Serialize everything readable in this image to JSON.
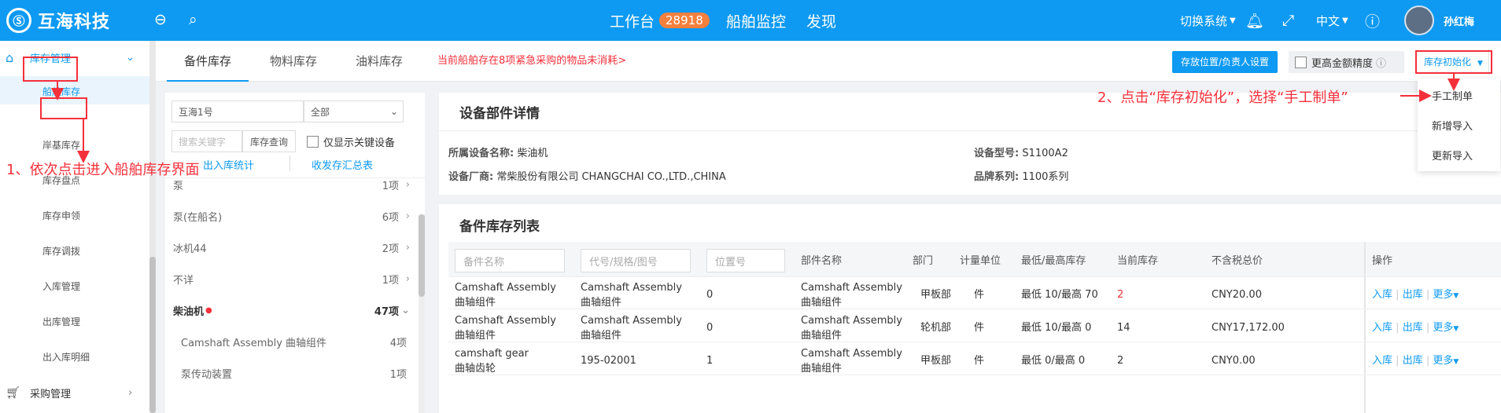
{
  "header": {
    "logo_mark": "Ⓢ",
    "app_name": "互海科技",
    "nav_workbench": "工作台",
    "workbench_badge": "28918",
    "nav_ship_monitor": "船舶监控",
    "nav_discover": "发现",
    "switch_system": "切换系统",
    "language": "中文",
    "user_name": "孙红梅"
  },
  "sidebar": {
    "group_inventory": "库存管理",
    "items": [
      "船舶库存",
      "岸基库存",
      "库存盘点",
      "库存申领",
      "库存调拨",
      "入库管理",
      "出库管理",
      "出入库明细"
    ],
    "group_purchase": "采购管理"
  },
  "tabs": [
    "备件库存",
    "物料库存",
    "油料库存"
  ],
  "warning": "当前船舶存在8项紧急采购的物品未消耗>",
  "toolbar": {
    "storage_setting": "存放位置/负责人设置",
    "high_precision": "更高金额精度",
    "init_button": "库存初始化"
  },
  "dropdown": [
    "手工制单",
    "新增导入",
    "更新导入"
  ],
  "left": {
    "ship": "互海1号",
    "filter": "全部",
    "search_placeholder": "搜索关键字",
    "search_btn": "库存查询",
    "key_only": "仅显示关键设备",
    "link_stats": "出入库统计",
    "link_summary": "收发存汇总表",
    "rows": [
      {
        "name": "泵",
        "count": "1项"
      },
      {
        "name": "泵(在船名)",
        "count": "6项"
      },
      {
        "name": "冰机44",
        "count": "2项"
      },
      {
        "name": "不详",
        "count": "1项"
      },
      {
        "name": "柴油机",
        "count": "47项"
      },
      {
        "name": "Camshaft Assembly 曲轴组件",
        "count": "4项"
      },
      {
        "name": "泵传动装置",
        "count": "1项"
      }
    ]
  },
  "detail": {
    "title": "设备部件详情",
    "label_device": "所属设备名称:",
    "device": "柴油机",
    "label_model": "设备型号:",
    "model": "S1100A2",
    "label_maker": "设备厂商:",
    "maker": "常柴股份有限公司 CHANGCHAI CO.,LTD.,CHINA",
    "label_brand": "品牌系列:",
    "brand": "1100系列"
  },
  "table": {
    "title": "备件库存列表",
    "filters": [
      "备件名称",
      "代号/规格/图号",
      "位置号"
    ],
    "headers": [
      "部件名称",
      "部门",
      "计量单位",
      "最低/最高库存",
      "当前库存",
      "不含税总价",
      "操作"
    ],
    "rows": [
      {
        "name": "Camshaft Assembly 曲轴组件",
        "code": "Camshaft Assembly 曲轴组件",
        "loc": "0",
        "part": "Camshaft Assembly 曲轴组件",
        "dept": "甲板部",
        "unit": "件",
        "minmax": "最低 10/最高 70",
        "stock": "2",
        "price": "CNY20.00"
      },
      {
        "name": "Camshaft Assembly 曲轴组件",
        "code": "Camshaft Assembly 曲轴组件",
        "loc": "0",
        "part": "Camshaft Assembly 曲轴组件",
        "dept": "轮机部",
        "unit": "件",
        "minmax": "最低 10/最高 0",
        "stock": "14",
        "price": "CNY17,172.00"
      },
      {
        "name": "camshaft gear 曲轴齿轮",
        "code": "195-02001",
        "loc": "1",
        "part": "Camshaft Assembly 曲轴组件",
        "dept": "甲板部",
        "unit": "件",
        "minmax": "最低 0/最高 0",
        "stock": "2",
        "price": "CNY0.00"
      }
    ],
    "ops": {
      "in": "入库",
      "out": "出库",
      "more": "更多"
    }
  },
  "annotations": {
    "step1": "1、依次点击进入船舶库存界面",
    "step2": "2、点击“库存初始化”，选择“手工制单”"
  }
}
